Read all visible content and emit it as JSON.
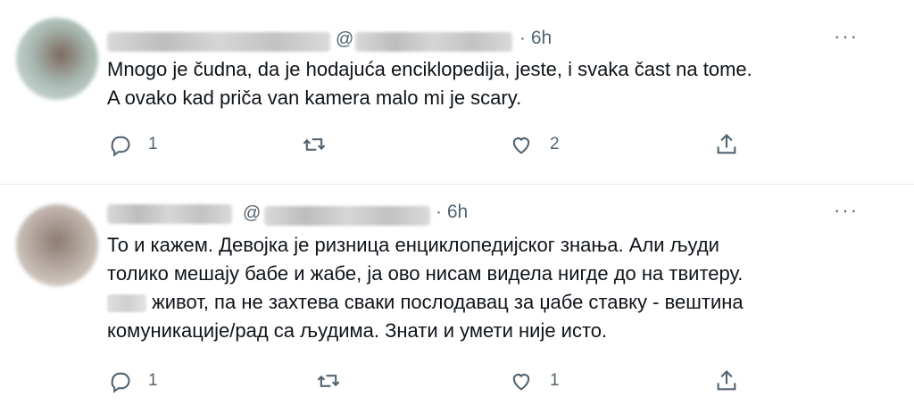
{
  "tweets": [
    {
      "handle_prefix": "@",
      "time": "· 6h",
      "more": "···",
      "lines": [
        "Mnogo je čudna, da je hodajuća enciklopedija, jeste, i svaka čast na tome.",
        "A ovako kad priča van kamera malo mi je scary."
      ],
      "reply_count": "1",
      "retweet_count": "",
      "like_count": "2"
    },
    {
      "handle_prefix": "@",
      "time": "· 6h",
      "more": "···",
      "lines": [
        "То и кажем. Девојка је ризница енциклопедијског знања. Али људи",
        "толико мешају бабе и жабе, ја ово нисам видела нигде до на твитеру.",
        "живот, па не захтева сваки послодавац за џабе ставку - вештина",
        "комуникације/рад са људима. Знати и умети није исто."
      ],
      "reply_count": "1",
      "retweet_count": "",
      "like_count": "1"
    }
  ],
  "icons": {
    "reply": "reply-icon",
    "retweet": "retweet-icon",
    "like": "heart-icon",
    "share": "share-icon",
    "more": "more-icon"
  }
}
